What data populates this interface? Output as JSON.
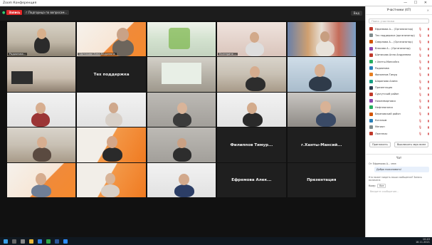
{
  "window": {
    "title": "Zoom Конференция",
    "controls": "— ☐ ✕"
  },
  "topbar": {
    "rec_label": "Запись",
    "meeting_name": "г.Подгорица по вопросам...",
    "view_label": "Вид"
  },
  "tiles": [
    {
      "label": "Радионова...",
      "center": ""
    },
    {
      "label": "Шитикова Анна Андреевна",
      "center": ""
    },
    {
      "label": "",
      "center": ""
    },
    {
      "label": "Екатерина ...",
      "center": ""
    },
    {
      "label": "",
      "center": ""
    },
    {
      "label": "",
      "center": ""
    },
    {
      "label": "",
      "center": "Тех поддержка"
    },
    {
      "label": "",
      "center": ""
    },
    {
      "label": "",
      "center": ""
    },
    {
      "label": "",
      "center": ""
    },
    {
      "label": "",
      "center": ""
    },
    {
      "label": "",
      "center": ""
    },
    {
      "label": "",
      "center": ""
    },
    {
      "label": "",
      "center": ""
    },
    {
      "label": "",
      "center": ""
    },
    {
      "label": "",
      "center": ""
    },
    {
      "label": "",
      "center": ""
    },
    {
      "label": "",
      "center": ""
    },
    {
      "label": "",
      "center": ""
    },
    {
      "label": "",
      "center": ""
    },
    {
      "label": "",
      "center": ""
    },
    {
      "label": "",
      "center": ""
    },
    {
      "label": "",
      "center": ""
    },
    {
      "label": "",
      "center": "Филиппов Тимур..."
    },
    {
      "label": "",
      "center": "г.Ханты-Мансий..."
    },
    {
      "label": "",
      "center": ""
    },
    {
      "label": "",
      "center": ""
    },
    {
      "label": "",
      "center": ""
    },
    {
      "label": "",
      "center": "Ефремова Алек..."
    },
    {
      "label": "",
      "center": "Презентация"
    }
  ],
  "panel": {
    "title": "Участники (47)",
    "search_placeholder": "Поиск участника",
    "participants": [
      {
        "name": "Ефремова А... (Организатор)",
        "color": "#c0392b"
      },
      {
        "name": "Тех поддержка (организатор)",
        "color": "#7f8c8d"
      },
      {
        "name": "Смирнова А... (Организатор)",
        "color": "#d35400"
      },
      {
        "name": "Власова А... (Организатор)",
        "color": "#8e44ad"
      },
      {
        "name": "Шитикова Анна Андреевна",
        "color": "#c0392b"
      },
      {
        "name": "г.Ханты-Мансийск",
        "color": "#27ae60"
      },
      {
        "name": "Радионова",
        "color": "#2980b9"
      },
      {
        "name": "Филиппов Тимур",
        "color": "#e67e22"
      },
      {
        "name": "Шарипова Алина",
        "color": "#16a085"
      },
      {
        "name": "Презентация",
        "color": "#2c3e50"
      },
      {
        "name": "Сургутский район",
        "color": "#c0392b"
      },
      {
        "name": "Нижневартовск",
        "color": "#8e44ad"
      },
      {
        "name": "Нефтеюганск",
        "color": "#27ae60"
      },
      {
        "name": "Березовский район",
        "color": "#d35400"
      },
      {
        "name": "Когалым",
        "color": "#2980b9"
      },
      {
        "name": "Мегион",
        "color": "#7f8c8d"
      },
      {
        "name": "Лангепас",
        "color": "#c0392b"
      }
    ],
    "invite_label": "Пригласить",
    "mute_all_label": "Выключить звук всем",
    "chat_title": "Чат",
    "chat_from": "От Ефремова А... мне:",
    "chat_text": "Добро пожаловать!",
    "chat_note": "Кто может видеть ваши сообщения? Запись включена",
    "chat_to_label": "Кому:",
    "chat_to_value": "Все",
    "chat_input_placeholder": "Введите сообщение..."
  },
  "taskbar": {
    "time": "10:43",
    "date": "18.11.2021"
  }
}
